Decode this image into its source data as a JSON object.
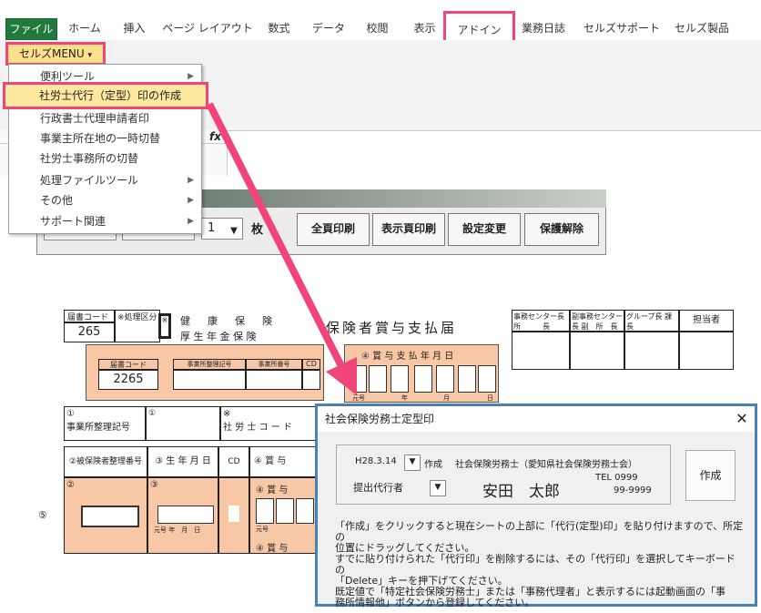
{
  "ribbon": {
    "tabs": [
      "ファイル",
      "ホーム",
      "挿入",
      "ページ レイアウト",
      "数式",
      "データ",
      "校閲",
      "表示",
      "アドイン",
      "業務日誌",
      "セルズサポート",
      "セルズ製品"
    ]
  },
  "menu": {
    "button_label": "セルズMENU",
    "button_arrow": "▾",
    "items": [
      {
        "label": "便利ツール",
        "sub": true
      },
      {
        "label": "社労士代行（定型）印の作成",
        "sub": false
      },
      {
        "label": "行政書士代理申請者印",
        "sub": false
      },
      {
        "label": "事業主所在地の一時切替",
        "sub": false
      },
      {
        "label": "社労士事務所の切替",
        "sub": false
      },
      {
        "label": "処理ファイルツール",
        "sub": true
      },
      {
        "label": "その他",
        "sub": true
      },
      {
        "label": "サポート関連",
        "sub": true
      }
    ]
  },
  "formula": {
    "fx": "fx"
  },
  "toolbar": {
    "page_value": "1",
    "page_unit": "枚",
    "buttons": [
      "全頁印刷",
      "表示頁印刷",
      "設定変更",
      "保護解除"
    ]
  },
  "form": {
    "header_label": "届書コード",
    "header_value": "265",
    "process_label": "※処理区分",
    "mark": "※",
    "title_left1": "健　康　保　険",
    "title_left2": "厚 生 年 金 保 険",
    "title_main": "保険者賞与支払届",
    "code_label": "届書コード",
    "code_value": "2265",
    "office_code_label": "事業所整理記号",
    "office_num_label": "事業所番号",
    "cd": "CD",
    "pay_date_label": "④ 賞 与 支 払 年 月 日",
    "era": "元号",
    "year": "年",
    "month": "月",
    "day": "日",
    "row1_num": "①",
    "row1_label": "事業所整理記号",
    "row1b": "①",
    "sr_label": "社 労 士 コ ー ド",
    "asterisk": "※",
    "col1": "②被保険者整理番号",
    "col2": "③ 生 年 月 日",
    "col3": "CD",
    "col4": "④ 賞 与",
    "side": "⑤",
    "r_era": "元号",
    "r_ymd": "年　月　日",
    "bonus": "④ 賞 与",
    "bonus2": "④ 賞 与"
  },
  "stamp_table": {
    "headers": [
      "事務センター長 所　　　長",
      "副事務センター長 副　所　長",
      "グループ長 課　　　長",
      "担当者"
    ]
  },
  "dialog": {
    "title": "社会保険労務士定型印",
    "close": "✕",
    "date": "H28.3.14",
    "made": "作成",
    "org": "社会保険労務士（愛知県社会保険労務士会）",
    "agent_label": "提出代行者",
    "name": "安田　太郎",
    "tel1": "TEL 0999",
    "tel2": "99-9999",
    "create_button": "作成",
    "notes": [
      "「作成」をクリックすると現在シートの上部に「代行(定型)印」を貼り付けますので、所定の",
      "位置にドラッグしてください。",
      "すでに貼り付けられた「代行印」を削除するには、その「代行印」を選択してキーボードの",
      "「Delete」キーを押下げてください。",
      "既定値で「特定社会保険労務士」または「事務代理者」と表示するには起動画面の「事",
      "務所情報他」ボタンから登録してください。"
    ]
  },
  "colors": {
    "accent": "#f0447a",
    "file_tab": "#217a3c",
    "menu_bg": "#fde08a",
    "form_orange": "#f8c7a5",
    "dialog_border": "#4a7fb8"
  }
}
